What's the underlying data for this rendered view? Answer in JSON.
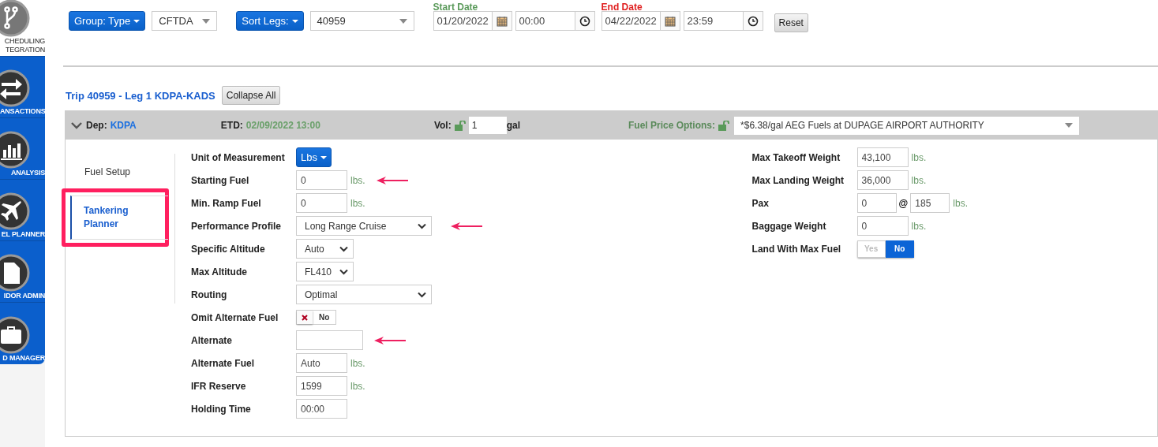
{
  "sidebar": {
    "items": [
      {
        "label": "CHEDULING TEGRATION",
        "selected": true
      },
      {
        "label": "ANSACTIONS",
        "selected": false
      },
      {
        "label": "ANALYSIS",
        "selected": false
      },
      {
        "label": "EL PLANNER",
        "selected": false
      },
      {
        "label": "IDOR ADMIN",
        "selected": false
      },
      {
        "label": "D MANAGER",
        "selected": false
      }
    ]
  },
  "toolbar": {
    "group_button": "Group: Type",
    "group_value": "CFTDA",
    "sort_button": "Sort Legs:",
    "sort_value": "40959",
    "start_date": {
      "label": "Start Date",
      "date": "01/20/2022",
      "time": "00:00"
    },
    "end_date": {
      "label": "End Date",
      "date": "04/22/2022",
      "time": "23:59"
    },
    "reset": "Reset"
  },
  "trip": {
    "title": "Trip 40959 - Leg 1 KDPA-KADS",
    "collapse": "Collapse All"
  },
  "leg_header": {
    "expanded": true,
    "dep_label": "Dep:",
    "dep": "KDPA",
    "etd_label": "ETD:",
    "etd": "02/09/2022 13:00",
    "vol_label": "Vol:",
    "vol": "1",
    "vol_unit": "gal",
    "price_label": "Fuel Price Options:",
    "price": "*$6.38/gal AEG Fuels at DUPAGE AIRPORT AUTHORITY"
  },
  "tabs": [
    {
      "label": "Fuel Setup",
      "selected": false,
      "highlighted": false
    },
    {
      "label": "Tankering Planner",
      "selected": true,
      "highlighted": true
    }
  ],
  "left_fields": [
    {
      "kind": "unit",
      "label": "Unit of Measurement",
      "value": "Lbs",
      "arrow": false
    },
    {
      "kind": "input",
      "label": "Starting Fuel",
      "value": "0",
      "unit": "lbs.",
      "arrow": true
    },
    {
      "kind": "input",
      "label": "Min. Ramp Fuel",
      "value": "0",
      "unit": "lbs.",
      "arrow": false
    },
    {
      "kind": "select-wide",
      "label": "Performance Profile",
      "value": "Long Range Cruise",
      "arrow": true
    },
    {
      "kind": "select",
      "label": "Specific Altitude",
      "value": "Auto",
      "arrow": false
    },
    {
      "kind": "select",
      "label": "Max Altitude",
      "value": "FL410",
      "arrow": false
    },
    {
      "kind": "select-wide",
      "label": "Routing",
      "value": "Optimal",
      "arrow": false
    },
    {
      "kind": "switch",
      "label": "Omit Alternate Fuel",
      "value": "No",
      "on": false,
      "arrow": false
    },
    {
      "kind": "input-wide",
      "label": "Alternate",
      "arrow": true
    },
    {
      "kind": "input",
      "label": "Alternate Fuel",
      "value": "Auto",
      "unit": "lbs.",
      "arrow": false
    },
    {
      "kind": "input",
      "label": "IFR Reserve",
      "value": "1599",
      "unit": "lbs.",
      "arrow": false
    },
    {
      "kind": "input",
      "label": "Holding Time",
      "value": "00:00",
      "arrow": false
    }
  ],
  "right_fields": [
    {
      "kind": "input",
      "label": "Max Takeoff Weight",
      "value": "43,100",
      "unit": "lbs."
    },
    {
      "kind": "input",
      "label": "Max Landing Weight",
      "value": "36,000",
      "unit": "lbs."
    },
    {
      "kind": "pax",
      "label": "Pax",
      "value": "0",
      "at": "@",
      "each": "185",
      "unit": "lbs."
    },
    {
      "kind": "input",
      "label": "Baggage Weight",
      "value": "0",
      "unit": "lbs."
    },
    {
      "kind": "yesno",
      "label": "Land With Max Fuel",
      "options": [
        {
          "label": "Yes",
          "selected": false
        },
        {
          "label": "No",
          "selected": true
        }
      ]
    }
  ]
}
